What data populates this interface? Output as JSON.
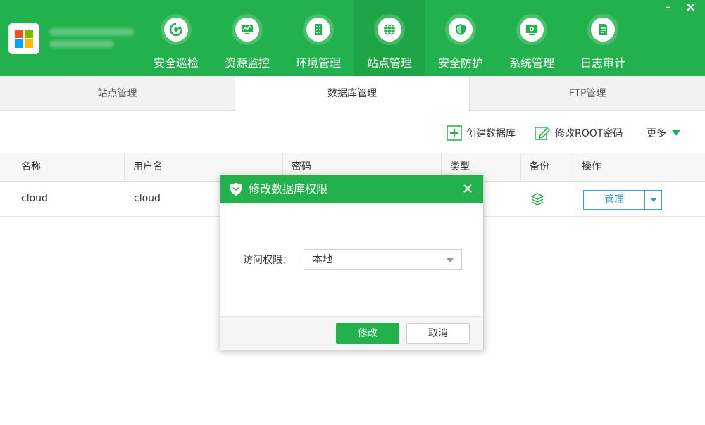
{
  "colors": {
    "brand_green": "#22b14c",
    "active_nav": "#1ea545",
    "link_blue": "#3a9be0"
  },
  "window_controls": {
    "minimize": "–",
    "close": "×"
  },
  "nav": [
    {
      "label": "安全巡检",
      "icon": "refresh-shield-icon"
    },
    {
      "label": "资源监控",
      "icon": "monitor-icon"
    },
    {
      "label": "环境管理",
      "icon": "building-icon"
    },
    {
      "label": "站点管理",
      "icon": "globe-icon",
      "active": true
    },
    {
      "label": "安全防护",
      "icon": "shield-icon"
    },
    {
      "label": "系统管理",
      "icon": "settings-icon"
    },
    {
      "label": "日志审计",
      "icon": "document-icon"
    }
  ],
  "tabs": [
    {
      "label": "站点管理"
    },
    {
      "label": "数据库管理",
      "active": true
    },
    {
      "label": "FTP管理"
    }
  ],
  "toolbar": {
    "create_label": "创建数据库",
    "modify_root_label": "修改ROOT密码",
    "more_label": "更多"
  },
  "table": {
    "headers": [
      "名称",
      "用户名",
      "密码",
      "类型",
      "备份",
      "操作"
    ],
    "rows": [
      {
        "name": "cloud",
        "user": "cloud",
        "action_label": "管理",
        "backup_icon": "layers-icon"
      }
    ]
  },
  "modal": {
    "title": "修改数据库权限",
    "field_label": "访问权限：",
    "field_value": "本地",
    "ok_label": "修改",
    "cancel_label": "取消"
  }
}
